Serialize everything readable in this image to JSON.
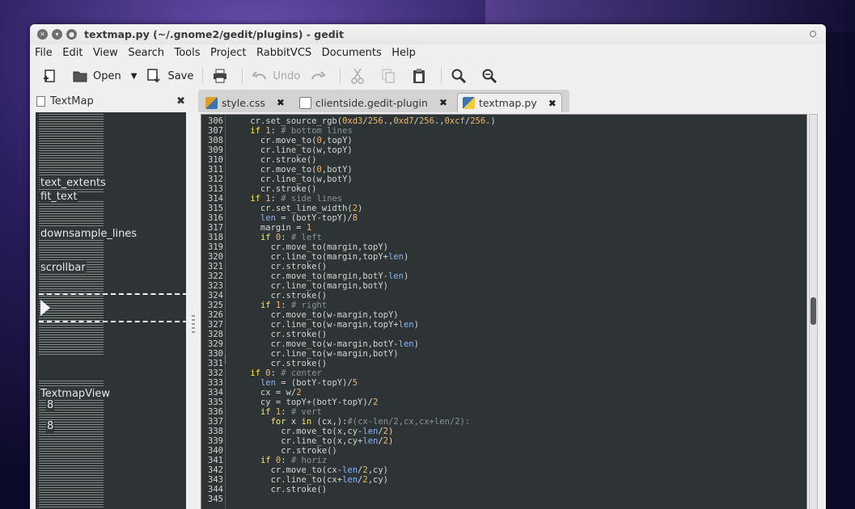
{
  "window": {
    "title": "textmap.py (~/.gnome2/gedit/plugins) - gedit"
  },
  "menu": [
    "File",
    "Edit",
    "View",
    "Search",
    "Tools",
    "Project",
    "RabbitVCS",
    "Documents",
    "Help"
  ],
  "toolbar": {
    "open_label": "Open",
    "save_label": "Save",
    "undo_label": "Undo"
  },
  "side_panel": {
    "title": "TextMap",
    "labels": [
      {
        "text": "text_extents"
      },
      {
        "text": "fit_text"
      },
      {
        "text": "downsample_lines"
      },
      {
        "text": "scrollbar"
      },
      {
        "text": "TextmapView"
      },
      {
        "text": "8"
      },
      {
        "text": "8"
      }
    ]
  },
  "tabs": [
    {
      "label": "style.css",
      "icon": "css-file-icon",
      "color": "#d9a02a"
    },
    {
      "label": "clientside.gedit-plugin",
      "icon": "text-file-icon",
      "color": "#ffffff"
    },
    {
      "label": "textmap.py",
      "icon": "python-file-icon",
      "color": "#3f73b0",
      "active": true
    }
  ],
  "editor": {
    "lines": [
      {
        "n": "306",
        "t": "    cr.set_source_rgb(0xd3/256.,0xd7/256.,0xcf/256.)"
      },
      {
        "n": "307",
        "t": "    if 1: # bottom lines"
      },
      {
        "n": "308",
        "t": "      cr.move_to(0,topY)"
      },
      {
        "n": "309",
        "t": "      cr.line_to(w,topY)"
      },
      {
        "n": "310",
        "t": "      cr.stroke()"
      },
      {
        "n": "311",
        "t": "      cr.move_to(0,botY)"
      },
      {
        "n": "312",
        "t": "      cr.line_to(w,botY)"
      },
      {
        "n": "313",
        "t": "      cr.stroke()"
      },
      {
        "n": "314",
        "t": "    if 1: # side lines"
      },
      {
        "n": "315",
        "t": "      cr.set_line_width(2)"
      },
      {
        "n": "316",
        "t": "      len = (botY-topY)/8"
      },
      {
        "n": "317",
        "t": "      margin = 1"
      },
      {
        "n": "318",
        "t": "      if 0: # left"
      },
      {
        "n": "319",
        "t": "        cr.move_to(margin,topY)"
      },
      {
        "n": "320",
        "t": "        cr.line_to(margin,topY+len)"
      },
      {
        "n": "321",
        "t": "        cr.stroke()"
      },
      {
        "n": "322",
        "t": "        cr.move_to(margin,botY-len)"
      },
      {
        "n": "323",
        "t": "        cr.line_to(margin,botY)"
      },
      {
        "n": "324",
        "t": "        cr.stroke()"
      },
      {
        "n": "325",
        "t": "      if 1: # right"
      },
      {
        "n": "326",
        "t": "        cr.move_to(w-margin,topY)"
      },
      {
        "n": "327",
        "t": "        cr.line_to(w-margin,topY+len)"
      },
      {
        "n": "328",
        "t": "        cr.stroke()"
      },
      {
        "n": "329",
        "t": "        cr.move_to(w-margin,botY-len)"
      },
      {
        "n": "330",
        "t": "        cr.line_to(w-margin,botY)"
      },
      {
        "n": "331",
        "t": "        cr.stroke()"
      },
      {
        "n": "332",
        "t": "    if 0: # center"
      },
      {
        "n": "333",
        "t": "      len = (botY-topY)/5"
      },
      {
        "n": "334",
        "t": "      cx = w/2"
      },
      {
        "n": "335",
        "t": "      cy = topY+(botY-topY)/2"
      },
      {
        "n": "336",
        "t": "      if 1: # vert"
      },
      {
        "n": "337",
        "t": "        for x in (cx,):#(cx-len/2,cx,cx+len/2):"
      },
      {
        "n": "338",
        "t": "          cr.move_to(x,cy-len/2)"
      },
      {
        "n": "339",
        "t": "          cr.line_to(x,cy+len/2)"
      },
      {
        "n": "340",
        "t": "          cr.stroke()"
      },
      {
        "n": "341",
        "t": "      if 0: # horiz"
      },
      {
        "n": "342",
        "t": "        cr.move_to(cx-len/2,cy)"
      },
      {
        "n": "343",
        "t": "        cr.line_to(cx+len/2,cy)"
      },
      {
        "n": "344",
        "t": "        cr.stroke()"
      },
      {
        "n": "345",
        "t": ""
      }
    ]
  },
  "colors": {
    "editor_bg": "#2e3436",
    "number": "#e9b96e",
    "keyword": "#fce94f",
    "comment": "#8a9495"
  }
}
